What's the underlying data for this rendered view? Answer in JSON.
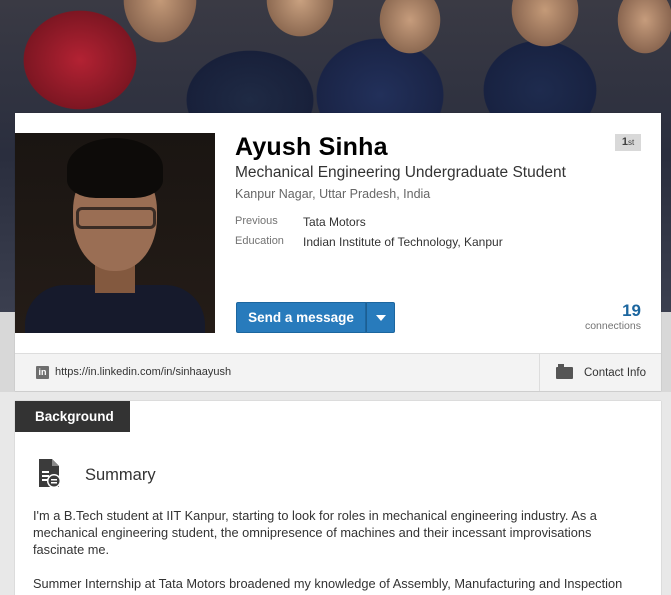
{
  "profile": {
    "name": "Ayush Sinha",
    "headline": "Mechanical Engineering Undergraduate Student",
    "location": "Kanpur Nagar, Uttar Pradesh, India",
    "degree": "1",
    "degree_suffix": "st",
    "facts": [
      {
        "label": "Previous",
        "value": "Tata Motors"
      },
      {
        "label": "Education",
        "value": "Indian Institute of Technology, Kanpur"
      }
    ],
    "send_message_label": "Send a message",
    "connections_count": "19",
    "connections_label": "connections",
    "public_url": "https://in.linkedin.com/in/sinhaayush",
    "contact_info_label": "Contact Info",
    "linkedin_badge": "in"
  },
  "background": {
    "tab_label": "Background",
    "summary_title": "Summary",
    "summary_paragraphs": [
      "I'm a B.Tech student at IIT Kanpur, starting to look for roles in mechanical engineering industry. As a mechanical engineering student, the omnipresence of machines and their incessant improvisations fascinate me.",
      "Summer Internship at Tata Motors broadened my knowledge of Assembly, Manufacturing and Inspection"
    ]
  },
  "colors": {
    "primary_button": "#287bbc",
    "connections_blue": "#1c669f",
    "tab_dark": "#333333"
  },
  "icons": {
    "linkedin": "linkedin-icon",
    "contact": "vcard-icon",
    "summary": "document-icon",
    "dropdown": "chevron-down-icon"
  }
}
